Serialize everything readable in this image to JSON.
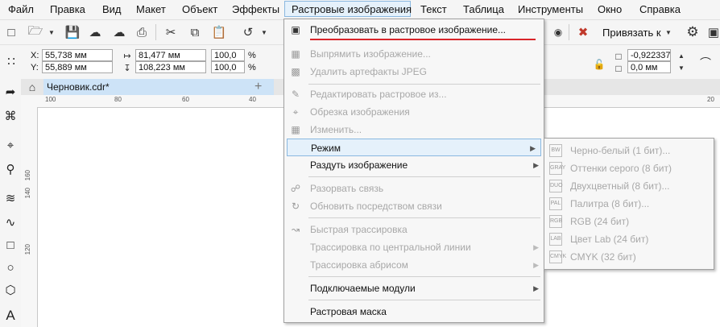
{
  "menubar": {
    "items": [
      {
        "label": "Файл"
      },
      {
        "label": "Правка"
      },
      {
        "label": "Вид"
      },
      {
        "label": "Макет"
      },
      {
        "label": "Объект"
      },
      {
        "label": "Эффекты"
      },
      {
        "label": "Растровые изображения"
      },
      {
        "label": "Текст"
      },
      {
        "label": "Таблица"
      },
      {
        "label": "Инструменты"
      },
      {
        "label": "Окно"
      },
      {
        "label": "Справка"
      }
    ],
    "active_index": 6
  },
  "toolbar": {
    "snap_label": "Привязать к"
  },
  "props": {
    "x_label": "X:",
    "y_label": "Y:",
    "x_value": "55,738 мм",
    "y_value": "55,889 мм",
    "width_value": "81,477 мм",
    "height_value": "108,223 мм",
    "scale_w": "100,0",
    "scale_h": "100,0",
    "pct": "%",
    "angle_value": "-0,922337",
    "offset_value": "0,0 мм"
  },
  "document": {
    "tab_label": "Черновик.cdr*",
    "add_tab": "+"
  },
  "ruler": {
    "h_ticks": [
      "100",
      "80",
      "60",
      "40",
      "20"
    ],
    "v_ticks": [
      "160",
      "140",
      "120"
    ]
  },
  "bitmap_menu": {
    "items": [
      {
        "label": "Преобразовать в растровое изображение...",
        "state": "enabled",
        "icon": "convert-icon"
      },
      {
        "label": "Выпрямить изображение...",
        "state": "disabled",
        "icon": "straighten-icon"
      },
      {
        "label": "Удалить артефакты JPEG",
        "state": "disabled",
        "icon": "jpeg-icon"
      },
      {
        "label": "Редактировать растровое из...",
        "state": "disabled",
        "icon": "edit-bitmap-icon"
      },
      {
        "label": "Обрезка изображения",
        "state": "disabled",
        "icon": "crop-bitmap-icon"
      },
      {
        "label": "Изменить...",
        "state": "disabled",
        "icon": "resample-icon"
      },
      {
        "label": "Режим",
        "state": "highlighted",
        "submenu": true
      },
      {
        "label": "Раздуть изображение",
        "state": "enabled",
        "submenu": true
      },
      {
        "label": "Разорвать связь",
        "state": "disabled",
        "icon": "break-link-icon"
      },
      {
        "label": "Обновить посредством связи",
        "state": "disabled",
        "icon": "update-link-icon"
      },
      {
        "label": "Быстрая трассировка",
        "state": "disabled",
        "icon": "quick-trace-icon"
      },
      {
        "label": "Трассировка по центральной линии",
        "state": "disabled",
        "submenu": true
      },
      {
        "label": "Трассировка абрисом",
        "state": "disabled",
        "submenu": true
      },
      {
        "label": "Подключаемые модули",
        "state": "enabled",
        "submenu": true
      },
      {
        "label": "Растровая маска",
        "state": "enabled"
      }
    ]
  },
  "mode_submenu": {
    "items": [
      {
        "label": "Черно-белый (1 бит)...",
        "icon": "BW"
      },
      {
        "label": "Оттенки серого (8 бит)",
        "icon": "GRAY"
      },
      {
        "label": "Двухцветный (8 бит)...",
        "icon": "DUO"
      },
      {
        "label": "Палитра (8 бит)...",
        "icon": "PAL"
      },
      {
        "label": "RGB (24 бит)",
        "icon": "RGB"
      },
      {
        "label": "Цвет Lab (24 бит)",
        "icon": "LAB"
      },
      {
        "label": "CMYK (32 бит)",
        "icon": "CMYK"
      }
    ]
  },
  "colors": {
    "accent_highlight": "#e5f1fb",
    "accent_border": "#8ab8e0",
    "underline_red": "#d9252a",
    "tab_blue": "#cde3f7"
  }
}
